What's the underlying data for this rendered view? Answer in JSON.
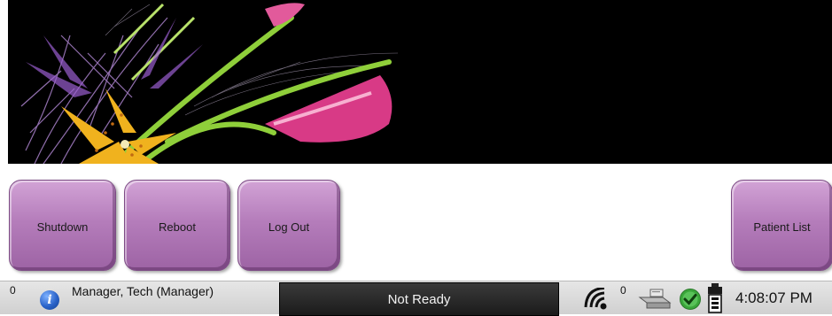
{
  "buttons": {
    "shutdown": "Shutdown",
    "reboot": "Reboot",
    "logout": "Log Out",
    "patient_list": "Patient List"
  },
  "status_bar": {
    "alarm_count": "0",
    "user": "Manager, Tech (Manager)",
    "status": "Not Ready",
    "queue_count": "0",
    "time": "4:08:07 PM",
    "icons": [
      "info-icon",
      "wireless-icon",
      "output-device-icon",
      "check-icon",
      "detector-battery-icon"
    ]
  },
  "colors": {
    "button_purple": "#b57dbb",
    "status_panel": "#1b1b1b",
    "banner": "#000000",
    "ok_green": "#3aa63a"
  }
}
